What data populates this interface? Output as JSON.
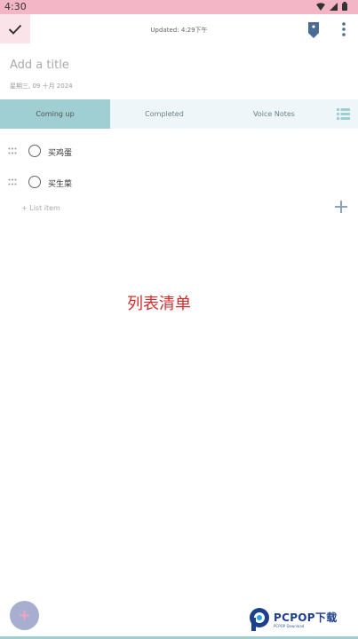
{
  "status_bar": {
    "time": "4:30",
    "bg": "#f2b6c6"
  },
  "toolbar": {
    "updated_text": "Updated: 4:29下午",
    "check_icon": "check-icon",
    "tag_icon": "tag-icon",
    "more_icon": "more-vert-icon"
  },
  "note": {
    "title_placeholder": "Add a title",
    "date": "星期三, 09 十月 2024"
  },
  "tabs": [
    {
      "label": "Coming up",
      "active": true
    },
    {
      "label": "Completed",
      "active": false
    },
    {
      "label": "Voice Notes",
      "active": false
    }
  ],
  "list": {
    "items": [
      {
        "text": "买鸡蛋",
        "checked": false
      },
      {
        "text": "买生菜",
        "checked": false
      }
    ],
    "add_placeholder": "+ List item"
  },
  "overlay": {
    "text": "列表清单"
  },
  "fab": {
    "icon": "plus-icon"
  },
  "watermark": {
    "title": "PCPOP下载",
    "subtitle": "PCPOP Download"
  },
  "colors": {
    "accent_teal": "#9fcfd2",
    "status_pink": "#f2b6c6",
    "fab": "#a8aed0",
    "overlay_red": "#d32d2d",
    "icon_blue": "#4a6b94"
  }
}
